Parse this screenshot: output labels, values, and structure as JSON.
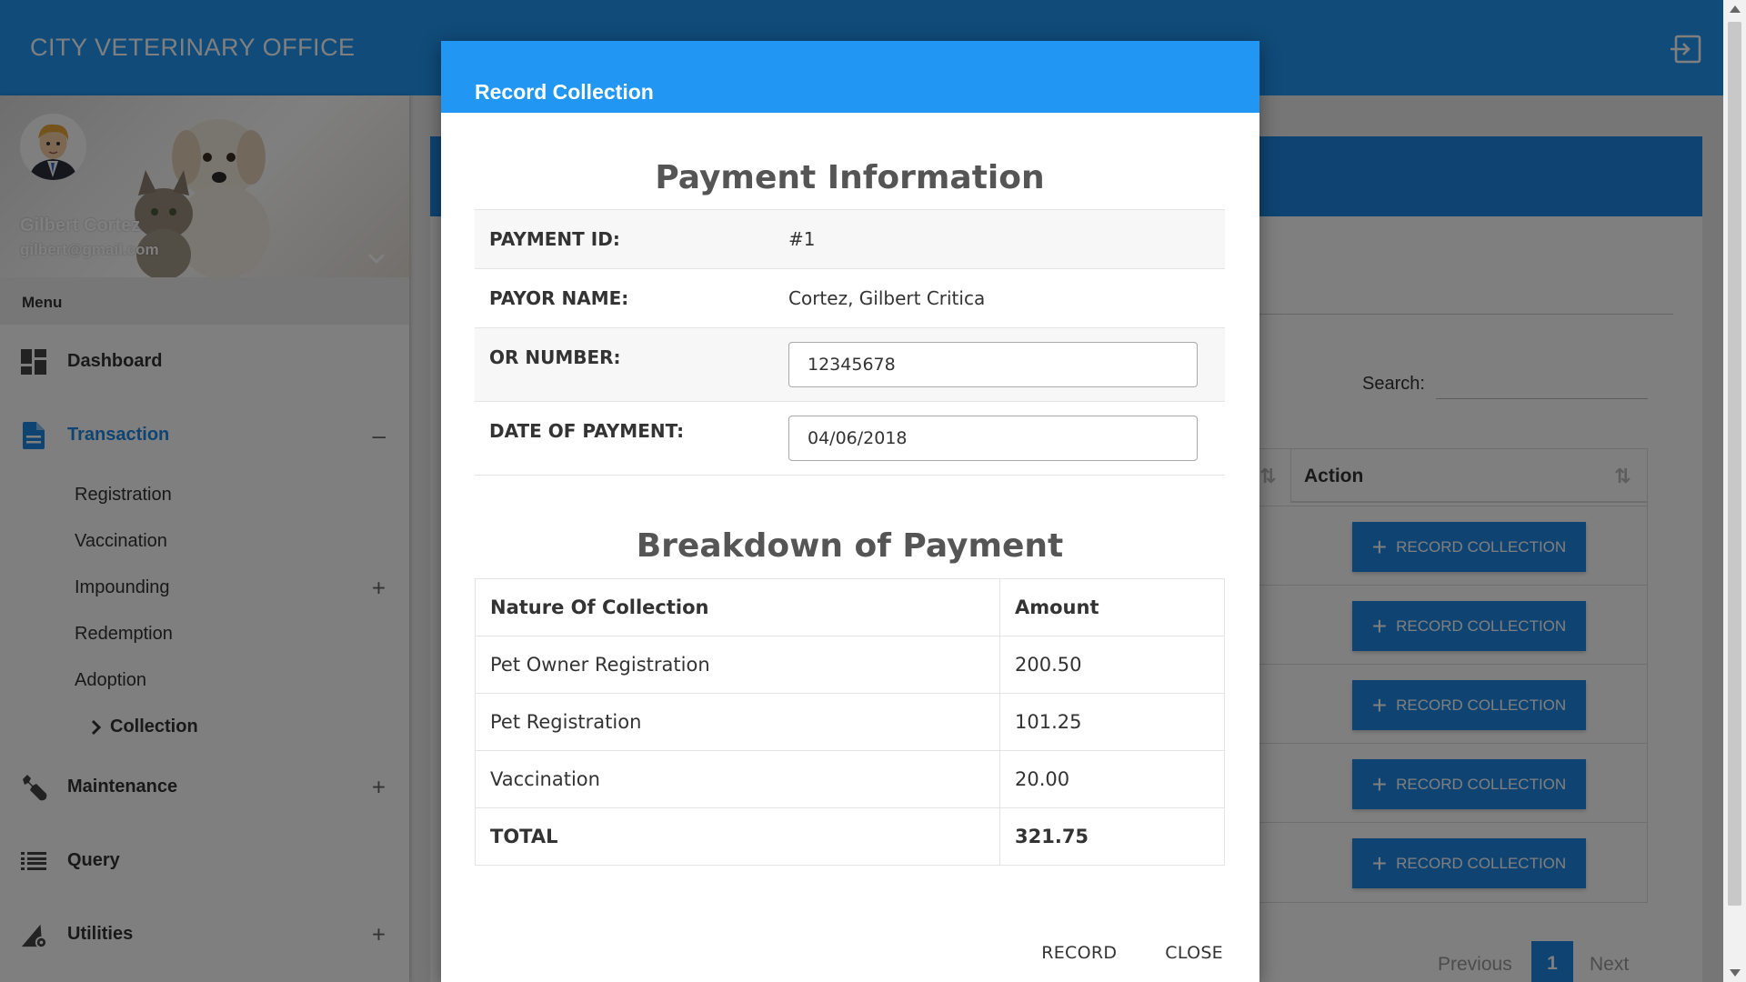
{
  "app": {
    "title": "CITY VETERINARY OFFICE",
    "logout_icon": "logout-icon"
  },
  "user": {
    "name": "Gilbert Cortez",
    "email": "gilbert@gmail.com"
  },
  "menu": {
    "header": "Menu",
    "items": [
      {
        "label": "Dashboard",
        "icon": "dashboard-icon"
      },
      {
        "label": "Transaction",
        "icon": "document-icon",
        "toggle": "–",
        "active": true
      },
      {
        "label": "Maintenance",
        "icon": "wrench-icon",
        "toggle": "+"
      },
      {
        "label": "Query",
        "icon": "list-icon"
      },
      {
        "label": "Utilities",
        "icon": "utilities-icon",
        "toggle": "+"
      }
    ],
    "transaction_sub": [
      {
        "label": "Registration"
      },
      {
        "label": "Vaccination"
      },
      {
        "label": "Impounding",
        "toggle": "+"
      },
      {
        "label": "Redemption"
      },
      {
        "label": "Adoption"
      },
      {
        "label": "Collection",
        "current": true
      }
    ]
  },
  "background_page": {
    "search_label": "Search:",
    "action_header": "Action",
    "row_button_label": "RECORD COLLECTION",
    "pagination": {
      "previous": "Previous",
      "current": "1",
      "next": "Next"
    }
  },
  "modal": {
    "title": "Record Collection",
    "payment_info_title": "Payment Information",
    "fields": {
      "payment_id": {
        "label": "PAYMENT ID:",
        "value": "#1"
      },
      "payor_name": {
        "label": "PAYOR NAME:",
        "value": "Cortez, Gilbert Critica"
      },
      "or_number": {
        "label": "OR NUMBER:",
        "value": "12345678"
      },
      "date_of_payment": {
        "label": "DATE OF PAYMENT:",
        "value": "04/06/2018"
      }
    },
    "breakdown_title": "Breakdown of Payment",
    "breakdown": {
      "headers": {
        "nature": "Nature Of Collection",
        "amount": "Amount"
      },
      "rows": [
        {
          "nature": "Pet Owner Registration",
          "amount": "200.50"
        },
        {
          "nature": "Pet Registration",
          "amount": "101.25"
        },
        {
          "nature": "Vaccination",
          "amount": "20.00"
        }
      ],
      "total": {
        "label": "TOTAL",
        "amount": "321.75"
      }
    },
    "buttons": {
      "record": "RECORD",
      "close": "CLOSE"
    }
  },
  "colors": {
    "primary": "#2196f3",
    "primary_dark": "#1e88e5",
    "overlay": "rgba(0,0,0,0.5)"
  }
}
